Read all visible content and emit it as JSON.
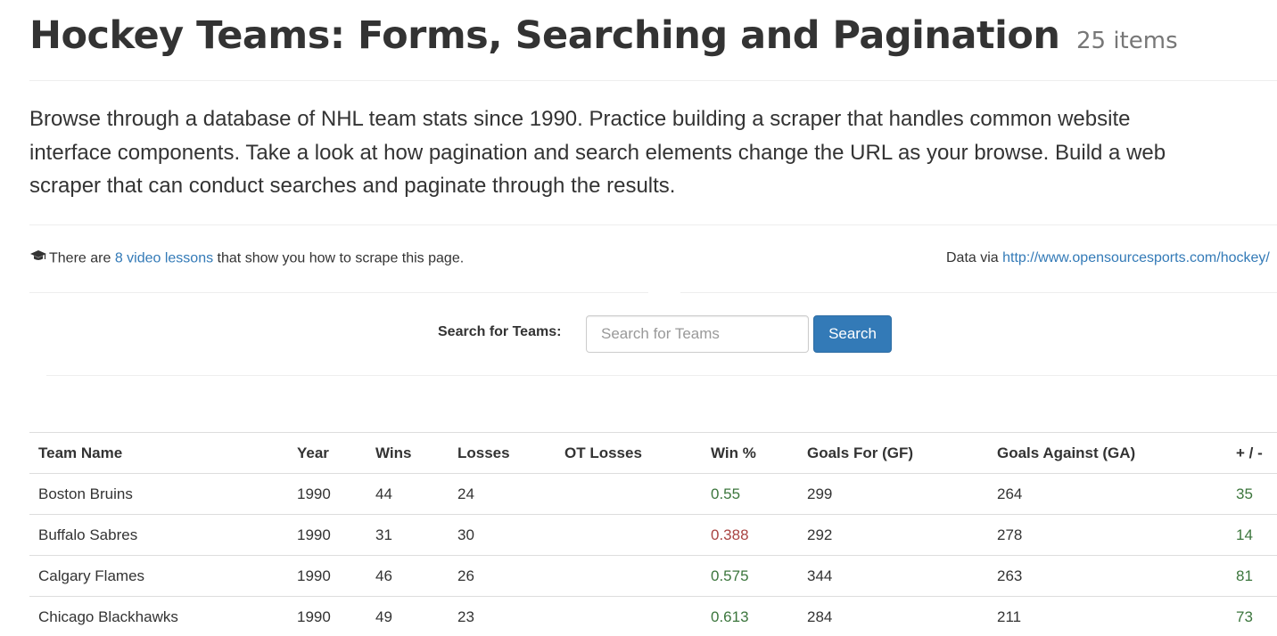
{
  "header": {
    "title": "Hockey Teams: Forms, Searching and Pagination",
    "count": "25 items"
  },
  "lead_text": [
    "Browse through a database of NHL team stats since 1990. Practice building a scraper that handles common website",
    "interface components. Take a look at how pagination and search elements change the URL as your browse. Build a web",
    "scraper that can conduct searches and paginate through the results."
  ],
  "lessons": {
    "icon": "graduation-cap-icon",
    "prefix": "There are ",
    "link_text": "8 video lessons",
    "suffix": " that show you how to scrape this page."
  },
  "data_source": {
    "prefix": "Data via ",
    "link_text": "http://www.opensourcesports.com/hockey/"
  },
  "search": {
    "label": "Search for Teams:",
    "placeholder": "Search for Teams",
    "value": "",
    "button_label": "Search"
  },
  "colors": {
    "link": "#337ab7",
    "button": "#337ab7",
    "success": "#3c763d",
    "danger": "#a94442"
  },
  "table": {
    "columns": [
      "Team Name",
      "Year",
      "Wins",
      "Losses",
      "OT Losses",
      "Win %",
      "Goals For (GF)",
      "Goals Against (GA)",
      "+ / -"
    ],
    "rows": [
      {
        "name": "Boston Bruins",
        "year": "1990",
        "wins": "44",
        "losses": "24",
        "ot_losses": "",
        "win_pct": "0.55",
        "gf": "299",
        "ga": "264",
        "diff": "35",
        "win_status": "good",
        "diff_status": "good"
      },
      {
        "name": "Buffalo Sabres",
        "year": "1990",
        "wins": "31",
        "losses": "30",
        "ot_losses": "",
        "win_pct": "0.388",
        "gf": "292",
        "ga": "278",
        "diff": "14",
        "win_status": "bad",
        "diff_status": "good"
      },
      {
        "name": "Calgary Flames",
        "year": "1990",
        "wins": "46",
        "losses": "26",
        "ot_losses": "",
        "win_pct": "0.575",
        "gf": "344",
        "ga": "263",
        "diff": "81",
        "win_status": "good",
        "diff_status": "good"
      },
      {
        "name": "Chicago Blackhawks",
        "year": "1990",
        "wins": "49",
        "losses": "23",
        "ot_losses": "",
        "win_pct": "0.613",
        "gf": "284",
        "ga": "211",
        "diff": "73",
        "win_status": "good",
        "diff_status": "good"
      }
    ]
  }
}
